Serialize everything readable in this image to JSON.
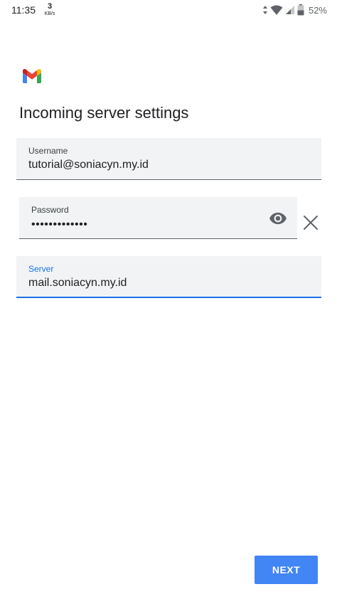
{
  "status_bar": {
    "time": "11:35",
    "net_speed_value": "3",
    "net_speed_unit": "KB/s",
    "battery_percent": "52%",
    "icons": [
      "data-arrows-icon",
      "wifi-icon",
      "cell-signal-icon",
      "battery-icon"
    ]
  },
  "app": {
    "logo": "gmail-logo",
    "title": "Incoming server settings"
  },
  "form": {
    "username": {
      "label": "Username",
      "value": "tutorial@soniacyn.my.id"
    },
    "password": {
      "label": "Password",
      "value": "•••••••••••••"
    },
    "server": {
      "label": "Server",
      "value": "mail.soniacyn.my.id"
    }
  },
  "actions": {
    "next_label": "NEXT"
  },
  "colors": {
    "accent": "#1a73e8",
    "button": "#4285f4",
    "field_bg": "#f1f3f4",
    "gmail_red": "#ea4335",
    "gmail_blue": "#4285f4",
    "gmail_green": "#34a853",
    "gmail_yellow": "#fbbc04"
  }
}
